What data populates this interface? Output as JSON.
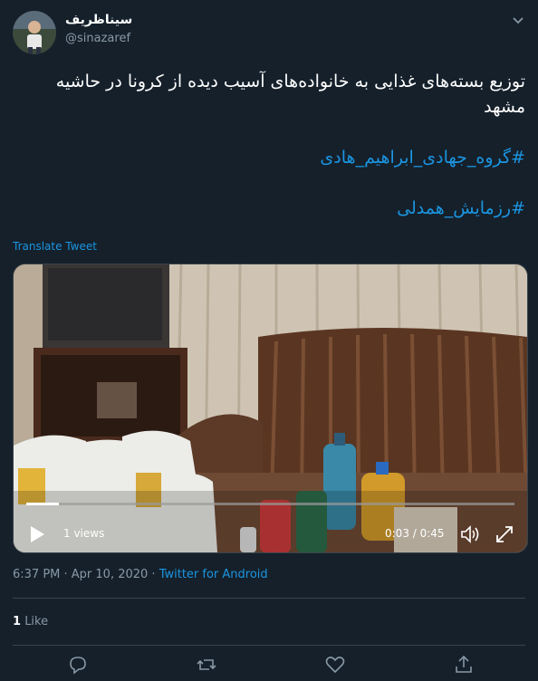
{
  "user": {
    "display_name": "سیناظریف",
    "handle": "@sinazaref"
  },
  "tweet": {
    "line1": "توزیع بسته‌های غذایی به خانواده‌های آسیب دیده از کرونا در حاشیه مشهد",
    "hashtag1": "#گروه_جهادی_ابراهیم_هادی",
    "hashtag2": "#رزمایش_همدلی",
    "translate_label": "Translate Tweet"
  },
  "video": {
    "views": "1 views",
    "time": "0:03 / 0:45",
    "progress": 0.067
  },
  "meta": {
    "time": "6:37 PM · Apr 10, 2020 · ",
    "source": "Twitter for Android"
  },
  "engagement": {
    "likes_count": "1",
    "likes_label": "Like"
  },
  "colors": {
    "background": "#15202b",
    "accent": "#1b95e0",
    "muted": "#8899a6",
    "border": "#38444d"
  },
  "icons": [
    "chevron-down-icon",
    "play-icon",
    "volume-icon",
    "fullscreen-icon",
    "reply-icon",
    "retweet-icon",
    "like-icon",
    "share-icon"
  ]
}
